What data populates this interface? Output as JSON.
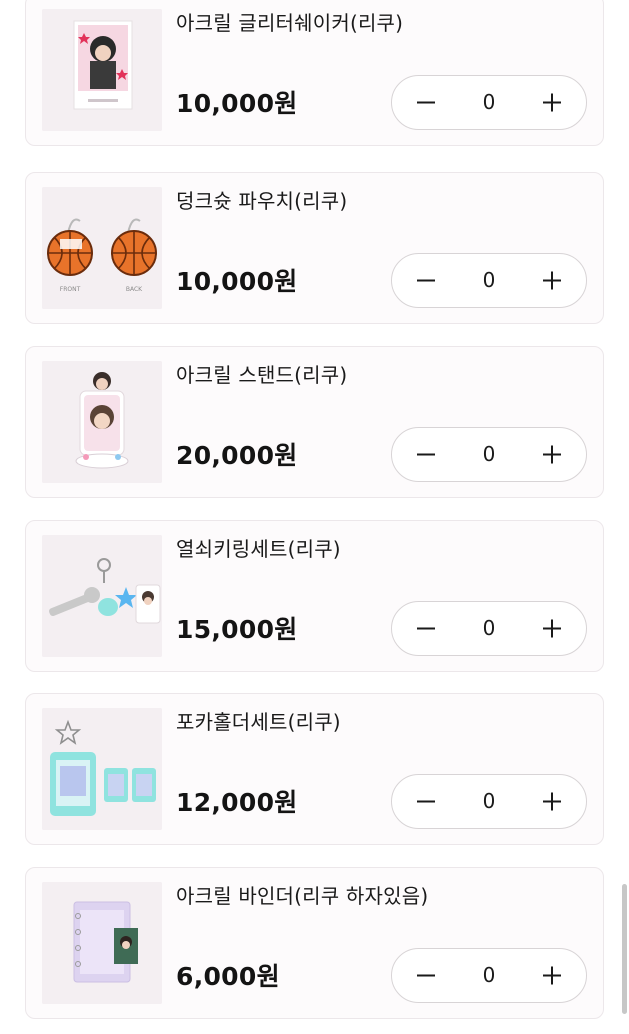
{
  "products": [
    {
      "name": "아크릴 글리터쉐이커(리쿠)",
      "price": "10,000원",
      "qty": "0",
      "thumb_icon": "acrylic-shaker-photo"
    },
    {
      "name": "덩크슛 파우치(리쿠)",
      "price": "10,000원",
      "qty": "0",
      "thumb_icon": "basketball-pouch-photo",
      "thumb_labels": [
        "FRONT",
        "BACK"
      ]
    },
    {
      "name": "아크릴 스탠드(리쿠)",
      "price": "20,000원",
      "qty": "0",
      "thumb_icon": "acrylic-stand-photo"
    },
    {
      "name": "열쇠키링세트(리쿠)",
      "price": "15,000원",
      "qty": "0",
      "thumb_icon": "key-keyring-set-photo"
    },
    {
      "name": "포카홀더세트(리쿠)",
      "price": "12,000원",
      "qty": "0",
      "thumb_icon": "photocard-holder-set-photo"
    },
    {
      "name": "아크릴 바인더(리쿠 하자있음)",
      "price": "6,000원",
      "qty": "0",
      "thumb_icon": "acrylic-binder-photo"
    }
  ],
  "stepper": {
    "minus_icon": "minus-icon",
    "plus_icon": "plus-icon"
  },
  "colors": {
    "card_bg": "#fdfbfc",
    "card_border": "#ece7ea",
    "thumb_bg": "#f4eff2",
    "text": "#1a1a1a",
    "stepper_border": "#d8d4d6",
    "basketball": "#e8732a",
    "mint": "#8fe3df"
  }
}
